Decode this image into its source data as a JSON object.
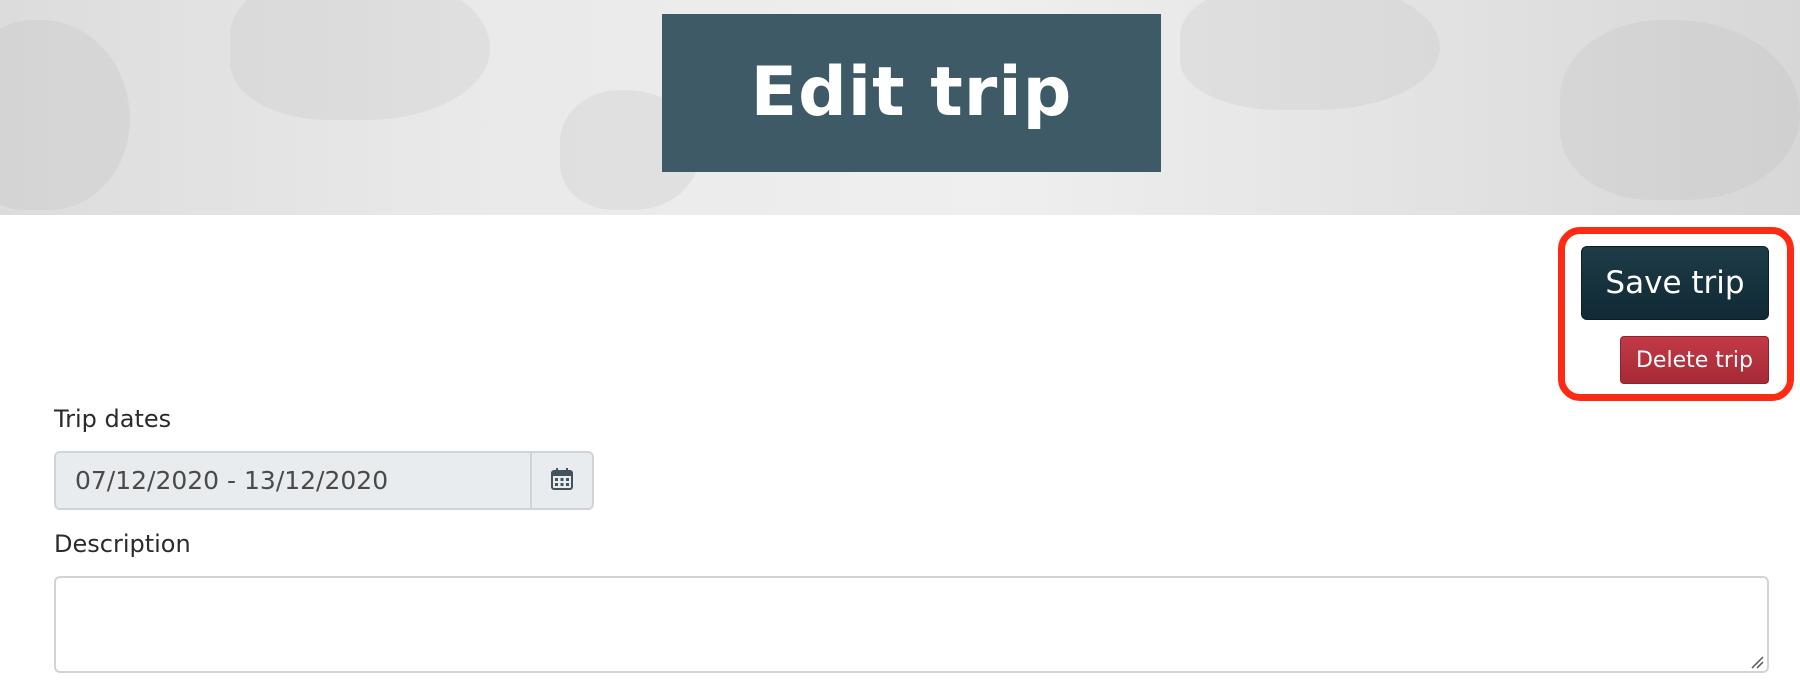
{
  "header": {
    "title": "Edit trip"
  },
  "actions": {
    "save_label": "Save trip",
    "delete_label": "Delete trip"
  },
  "form": {
    "dates_label": "Trip dates",
    "dates_value": "07/12/2020 - 13/12/2020",
    "calendar_icon": "calendar-icon",
    "description_label": "Description",
    "description_value": ""
  },
  "colors": {
    "title_bg": "#3d5a66",
    "save_bg": "#12303c",
    "delete_bg": "#b0303d",
    "highlight": "#ff2a14"
  }
}
